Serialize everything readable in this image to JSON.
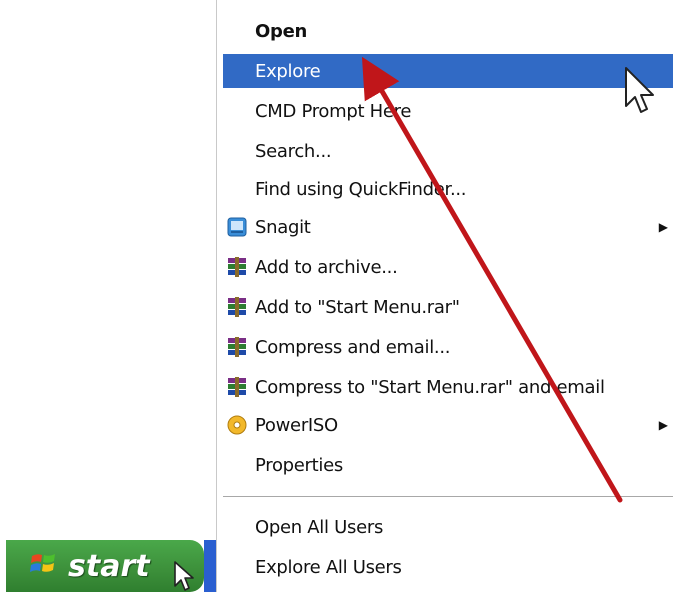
{
  "context_menu": {
    "items": [
      {
        "label": "Open",
        "bold": true,
        "icon": null,
        "submenu": false
      },
      {
        "label": "Explore",
        "selected": true,
        "icon": null,
        "submenu": false
      },
      {
        "label": "CMD Prompt Here",
        "icon": null,
        "submenu": false
      },
      {
        "label": "Search...",
        "icon": null,
        "submenu": false
      },
      {
        "label": "Find using QuickFinder...",
        "icon": null,
        "submenu": false
      },
      {
        "label": "Snagit",
        "icon": "snagit-icon",
        "submenu": true
      },
      {
        "label": "Add to archive...",
        "icon": "winrar-icon",
        "submenu": false
      },
      {
        "label": "Add to \"Start Menu.rar\"",
        "icon": "winrar-icon",
        "submenu": false
      },
      {
        "label": "Compress and email...",
        "icon": "winrar-icon",
        "submenu": false
      },
      {
        "label": "Compress to \"Start Menu.rar\" and email",
        "icon": "winrar-icon",
        "submenu": false
      },
      {
        "label": "PowerISO",
        "icon": "poweriso-icon",
        "submenu": true
      },
      {
        "label": "Properties",
        "icon": null,
        "submenu": false
      },
      {
        "label": "Open All Users",
        "icon": null,
        "submenu": false
      },
      {
        "label": "Explore All Users",
        "icon": null,
        "submenu": false
      }
    ]
  },
  "taskbar": {
    "start_label": "start"
  },
  "colors": {
    "selection": "#316ac5",
    "start_button": "#3c8f3a",
    "annotation_arrow": "#c0161a",
    "taskbar": "#2a5fd0"
  }
}
